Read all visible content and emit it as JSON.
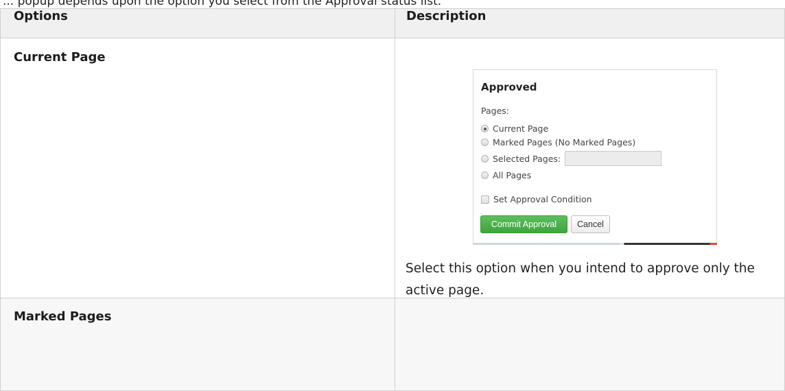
{
  "intro_text": "... popup depends upon the option you select from the Approval status list.",
  "table": {
    "headers": [
      "Options",
      "Description"
    ],
    "rows": [
      {
        "option": "Current Page",
        "description": "Select this option when you intend to approve only the active page."
      },
      {
        "option": "Marked Pages",
        "description": ""
      }
    ]
  },
  "dialog": {
    "title": "Approved",
    "pages_label": "Pages:",
    "radio_options": [
      {
        "label": "Current Page",
        "selected": true
      },
      {
        "label": "Marked Pages (No Marked Pages)",
        "selected": false
      },
      {
        "label": "Selected Pages:",
        "selected": false
      },
      {
        "label": "All Pages",
        "selected": false
      }
    ],
    "selected_pages_value": "",
    "checkbox_label": "Set Approval Condition",
    "checkbox_checked": false,
    "commit_button": "Commit Approval",
    "cancel_button": "Cancel",
    "colors": {
      "commit_green": "#4cae4c",
      "accent_orange": "#e04a2a"
    }
  }
}
